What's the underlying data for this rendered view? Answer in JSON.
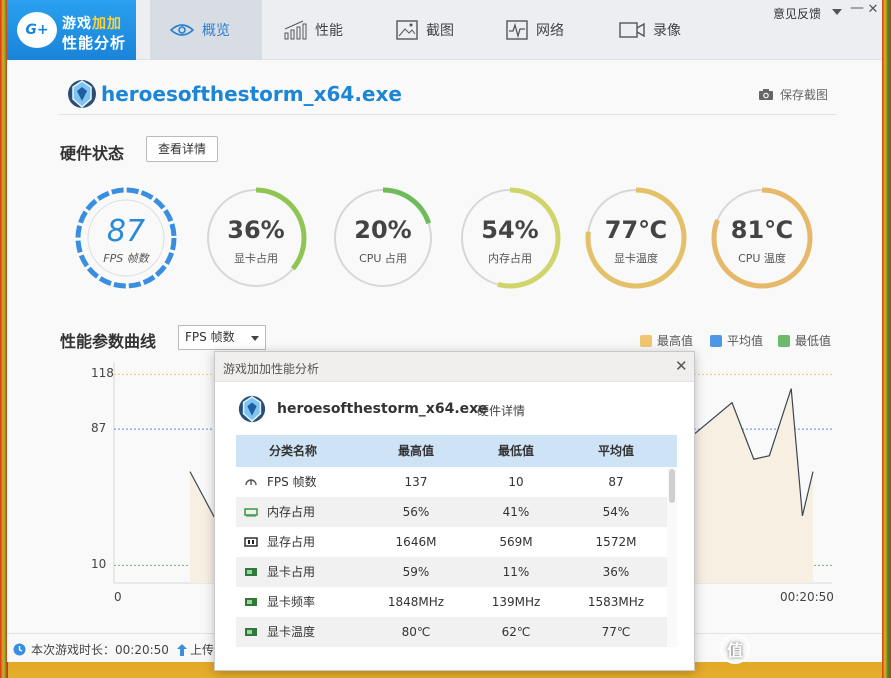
{
  "app": {
    "logo_badge": "G+",
    "logo_line1_a": "游戏",
    "logo_line1_b": "加加",
    "logo_line2": "性能分析",
    "tabs": [
      {
        "label": "概览",
        "icon": "eye-icon",
        "active": true
      },
      {
        "label": "性能",
        "icon": "bar-chart-icon",
        "active": false
      },
      {
        "label": "截图",
        "icon": "picture-icon",
        "active": false
      },
      {
        "label": "网络",
        "icon": "pulse-icon",
        "active": false
      },
      {
        "label": "录像",
        "icon": "video-camera-icon",
        "active": false
      }
    ],
    "feedback": "意见反馈",
    "minimize": "—",
    "close": "✕"
  },
  "header": {
    "exe_name": "heroesofthestorm_x64.exe",
    "save_screenshot": "保存截图"
  },
  "hardware": {
    "title": "硬件状态",
    "detail_button": "查看详情",
    "gauges": [
      {
        "value": "87",
        "label": "FPS 帧数",
        "fraction": 1.0,
        "color": "#3a8ee0"
      },
      {
        "value": "36%",
        "label": "显卡占用",
        "fraction": 0.36,
        "color": "#8fc653"
      },
      {
        "value": "20%",
        "label": "CPU 占用",
        "fraction": 0.2,
        "color": "#6dbb5a"
      },
      {
        "value": "54%",
        "label": "内存占用",
        "fraction": 0.54,
        "color": "#cfd56a"
      },
      {
        "value": "77℃",
        "label": "显卡温度",
        "fraction": 0.77,
        "color": "#e4c168"
      },
      {
        "value": "81℃",
        "label": "CPU 温度",
        "fraction": 0.81,
        "color": "#e6b86a"
      }
    ]
  },
  "curve": {
    "title": "性能参数曲线",
    "selected_metric": "FPS 帧数",
    "legend": [
      {
        "label": "最高值",
        "color": "#f2c571"
      },
      {
        "label": "平均值",
        "color": "#4e96e6"
      },
      {
        "label": "最低值",
        "color": "#6cbb6c"
      }
    ]
  },
  "chart_data": {
    "type": "line",
    "x_start_label": "0",
    "x_end_label": "00:20:50",
    "y_ticks": [
      118,
      87,
      10
    ],
    "ylim": [
      0,
      125
    ],
    "reference_lines": {
      "max": 118,
      "avg": 87,
      "min": 10
    },
    "series": [
      {
        "points_left": [
          [
            0.0,
            63
          ],
          [
            0.05,
            30
          ],
          [
            0.09,
            18
          ]
        ],
        "points_right": [
          [
            0.795,
            80
          ],
          [
            0.87,
            102
          ],
          [
            0.905,
            70
          ],
          [
            0.93,
            72
          ],
          [
            0.965,
            110
          ],
          [
            0.983,
            38
          ],
          [
            1.0,
            63
          ]
        ]
      }
    ]
  },
  "status": {
    "play_time": "本次游戏时长：00:20:50",
    "upload": "上传"
  },
  "dialog": {
    "title": "游戏加加性能分析",
    "close": "✕",
    "exe_name": "heroesofthestorm_x64.exe",
    "subtitle": "硬件详情",
    "columns": [
      "分类名称",
      "最高值",
      "最低值",
      "平均值"
    ],
    "rows": [
      {
        "icon": "gauge-icon",
        "name": "FPS 帧数",
        "max": "137",
        "min": "10",
        "avg": "87"
      },
      {
        "icon": "memory-icon",
        "name": "内存占用",
        "max": "56%",
        "min": "41%",
        "avg": "54%"
      },
      {
        "icon": "vram-icon",
        "name": "显存占用",
        "max": "1646M",
        "min": "569M",
        "avg": "1572M"
      },
      {
        "icon": "gpu-card-icon",
        "name": "显卡占用",
        "max": "59%",
        "min": "11%",
        "avg": "36%"
      },
      {
        "icon": "gpu-card-icon",
        "name": "显卡频率",
        "max": "1848MHz",
        "min": "139MHz",
        "avg": "1583MHz"
      },
      {
        "icon": "gpu-card-icon",
        "name": "显卡温度",
        "max": "80℃",
        "min": "62℃",
        "avg": "77℃"
      }
    ]
  },
  "watermark": {
    "text": "值 什么值得买"
  }
}
